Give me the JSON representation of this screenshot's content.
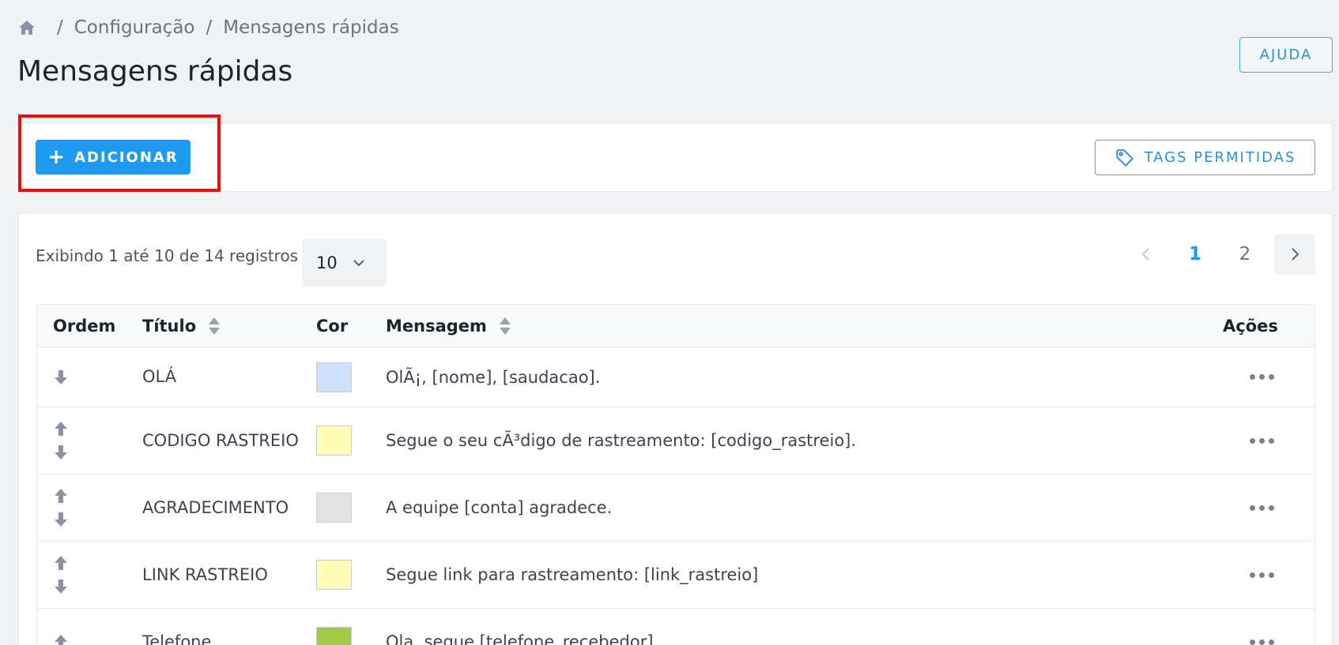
{
  "breadcrumb": {
    "items": [
      "Configuração",
      "Mensagens rápidas"
    ],
    "separator": "/"
  },
  "page": {
    "title": "Mensagens rápidas",
    "help_label": "AJUDA"
  },
  "toolbar": {
    "add_label": "ADICIONAR",
    "tags_label": "TAGS PERMITIDAS"
  },
  "listing": {
    "records_text": "Exibindo 1 até 10 de 14 registros",
    "per_page": "10",
    "pages": [
      "1",
      "2"
    ],
    "current_page": "1"
  },
  "table": {
    "headers": {
      "order": "Ordem",
      "title": "Título",
      "color": "Cor",
      "message": "Mensagem",
      "actions": "Ações"
    },
    "rows": [
      {
        "title": "OLÁ",
        "color": "#cfe0fb",
        "message": "OlÃ¡, [nome], [saudacao].",
        "up": false,
        "down": true
      },
      {
        "title": "CODIGO RASTREIO",
        "color": "#fdfdb8",
        "message": "Segue o seu cÃ³digo de rastreamento: [codigo_rastreio].",
        "up": true,
        "down": true
      },
      {
        "title": "AGRADECIMENTO",
        "color": "#e3e3e3",
        "message": "A equipe [conta] agradece.",
        "up": true,
        "down": true
      },
      {
        "title": "LINK RASTREIO",
        "color": "#fdfdb8",
        "message": "Segue link para rastreamento: [link_rastreio]",
        "up": true,
        "down": true
      },
      {
        "title": "Telefone",
        "color": "#a2cb45",
        "message": "Ola, segue [telefone_recebedor]",
        "up": true,
        "down": false
      }
    ]
  },
  "colors": {
    "primary": "#1e9bf0",
    "highlight": "#ee0d0d",
    "background": "#f1f2f4"
  }
}
